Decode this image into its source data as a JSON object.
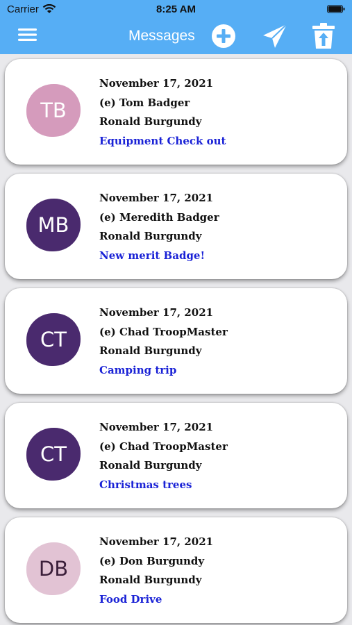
{
  "status_bar": {
    "carrier": "Carrier",
    "time": "8:25 AM"
  },
  "header": {
    "title": "Messages",
    "background": "#56aef5",
    "icons": [
      "menu-icon",
      "add-circle-icon",
      "send-icon",
      "trash-icon"
    ]
  },
  "messages": [
    {
      "initials": "TB",
      "avatar_bg": "#d59bbc",
      "avatar_fg": "#ffffff",
      "date": "November 17, 2021",
      "sender": "(e) Tom Badger",
      "recipient": "Ronald Burgundy",
      "subject": "Equipment Check out"
    },
    {
      "initials": "MB",
      "avatar_bg": "#4a2a6e",
      "avatar_fg": "#ffffff",
      "date": "November 17, 2021",
      "sender": "(e) Meredith Badger",
      "recipient": "Ronald Burgundy",
      "subject": "New merit Badge!"
    },
    {
      "initials": "CT",
      "avatar_bg": "#4a2a6e",
      "avatar_fg": "#ffffff",
      "date": "November 17, 2021",
      "sender": "(e) Chad TroopMaster",
      "recipient": "Ronald Burgundy",
      "subject": "Camping trip"
    },
    {
      "initials": "CT",
      "avatar_bg": "#4a2a6e",
      "avatar_fg": "#ffffff",
      "date": "November 17, 2021",
      "sender": "(e) Chad TroopMaster",
      "recipient": "Ronald Burgundy",
      "subject": "Christmas trees"
    },
    {
      "initials": "DB",
      "avatar_bg": "#e2c3d4",
      "avatar_fg": "#3b1f3a",
      "date": "November 17, 2021",
      "sender": "(e) Don Burgundy",
      "recipient": "Ronald Burgundy",
      "subject": "Food Drive"
    }
  ],
  "colors": {
    "subject": "#1a22d6",
    "card": "#ffffff"
  }
}
